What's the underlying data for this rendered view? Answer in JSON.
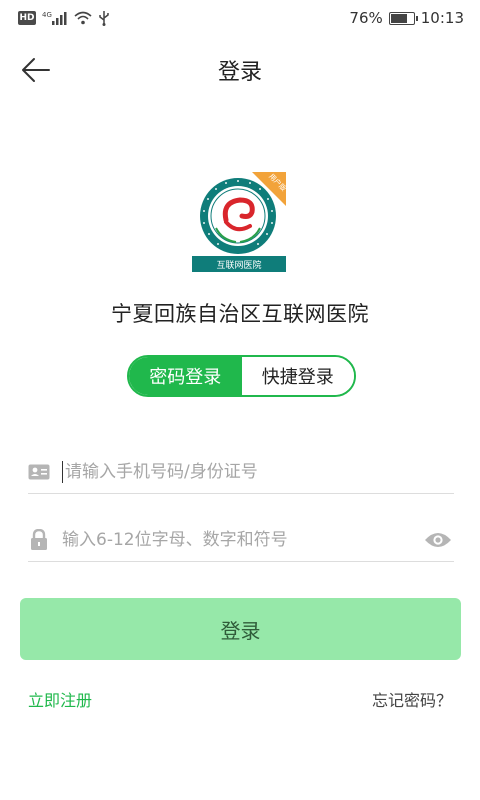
{
  "status_bar": {
    "hd_badge": "HD",
    "network_label": "4G",
    "battery_text": "76%",
    "battery_level": 0.76,
    "time": "10:13",
    "icons": [
      "signal-icon",
      "wifi-icon",
      "usb-icon",
      "battery-icon"
    ]
  },
  "header": {
    "title": "登录",
    "back_icon": "arrow-left-icon"
  },
  "logo": {
    "badge_text": "用户版",
    "banner_text": "互联网医院"
  },
  "hospital_name": "宁夏回族自治区互联网医院",
  "login_mode": {
    "options": [
      "密码登录",
      "快捷登录"
    ],
    "selected": "密码登录"
  },
  "form": {
    "username": {
      "value": "",
      "placeholder": "请输入手机号码/身份证号",
      "icon": "id-card-icon"
    },
    "password": {
      "value": "",
      "placeholder": "输入6-12位字母、数字和符号",
      "icon": "lock-icon",
      "toggle_icon": "eye-icon"
    }
  },
  "submit_label": "登录",
  "links": {
    "register": "立即注册",
    "forgot": "忘记密码？"
  },
  "colors": {
    "brand_green": "#20b84c",
    "button_disabled": "#96e8a9",
    "logo_teal": "#0f7d7a",
    "logo_badge": "#f2a33a"
  }
}
